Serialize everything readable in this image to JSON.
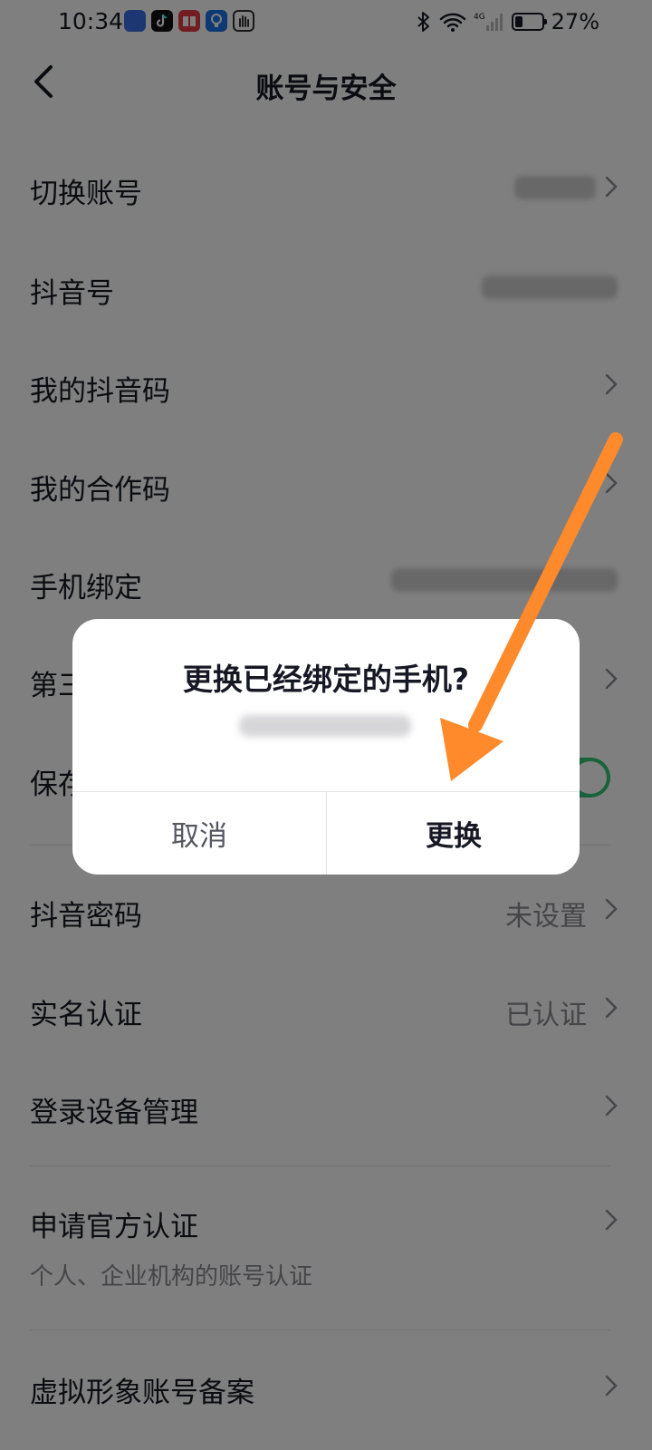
{
  "status_bar": {
    "time": "10:34",
    "battery_percent": "27%",
    "battery_level": 0.27,
    "network": "4G",
    "app_icons": [
      "music-app-icon",
      "tiktok-app-icon",
      "reader-app-icon",
      "bulb-app-icon",
      "hand-app-icon"
    ]
  },
  "header": {
    "title": "账号与安全",
    "back_icon": "chevron-left-icon"
  },
  "rows": [
    {
      "label": "切换账号",
      "value": "",
      "value_obscured": true
    },
    {
      "label": "抖音号",
      "value": "",
      "value_obscured": true
    },
    {
      "label": "我的抖音码",
      "value": ""
    },
    {
      "label": "我的合作码",
      "value": ""
    },
    {
      "label": "手机绑定",
      "value": "",
      "value_obscured": true
    },
    {
      "label": "第三方账号绑定",
      "value": ""
    },
    {
      "label": "保存登录信息",
      "value": "",
      "toggle_on": true
    },
    {
      "label": "抖音密码",
      "value": "未设置"
    },
    {
      "label": "实名认证",
      "value": "已认证"
    },
    {
      "label": "登录设备管理",
      "value": ""
    },
    {
      "label": "申请官方认证",
      "sublabel": "个人、企业机构的账号认证"
    },
    {
      "label": "虚拟形象账号备案",
      "value": ""
    }
  ],
  "dialog": {
    "title": "更换已经绑定的手机?",
    "message_obscured": true,
    "cancel_label": "取消",
    "confirm_label": "更换"
  },
  "colors": {
    "overlay": "rgba(0,0,0,0.5)",
    "toggle_on": "#35c477",
    "annotation_arrow": "#ff8a2b",
    "text_primary": "#161823",
    "text_secondary": "#8a8b91"
  }
}
